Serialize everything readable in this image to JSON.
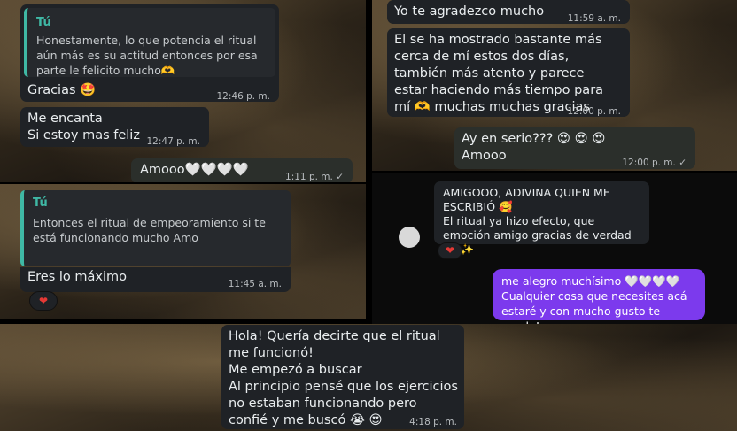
{
  "p1": {
    "quote_sender": "Tú",
    "quote_text": "Honestamente, lo que potencia el ritual aún más es su actitud entonces por esa parte le felicito mucho🫶",
    "msg1_text": "Gracias 🤩",
    "msg1_time": "12:46 p. m.",
    "msg2_text": "Me encanta\nSi estoy mas feliz",
    "msg2_time": "12:47 p. m.",
    "msg3_text": "Amooo🤍🤍🤍🤍",
    "msg3_time": "1:11 p. m. ✓"
  },
  "p2": {
    "msg1_text": "Yo te agradezco mucho",
    "msg1_time": "11:59 a. m.",
    "msg2_text": "El se ha mostrado bastante más cerca de mí estos dos días, también más atento y parece estar haciendo más tiempo para mí 🫶 muchas muchas gracias",
    "msg2_time": "12:00 p. m.",
    "msg3_text": "Ay en serio??? 😍 😍 😍\nAmooo",
    "msg3_time": "12:00 p. m. ✓"
  },
  "p3": {
    "quote_sender": "Tú",
    "quote_text": "Entonces el ritual de empeoramiento si te está funcionando mucho\nAmo",
    "msg_text": "Eres lo máximo",
    "msg_time": "11:45 a. m.",
    "reaction": "❤"
  },
  "p4": {
    "incoming_text": "AMIGOOO, ADIVINA QUIEN ME ESCRIBIÓ 🥰\nEl ritual ya hizo efecto, que emoción amigo gracias de verdad ✨ ✨",
    "reaction": "❤",
    "outgoing_text": "me alegro muchísimo 🤍🤍🤍🤍\nCualquier cosa que necesites acá estaré y con mucho gusto te ayudo!",
    "accent": "#7c3aed"
  },
  "p5": {
    "msg_text": "Hola! Quería decirte que el ritual me funcionó!\nMe empezó a buscar\nAl principio pensé que los ejercicios no estaban funcionando pero confié y me buscó 😭 😍",
    "msg_time": "4:18 p. m."
  }
}
